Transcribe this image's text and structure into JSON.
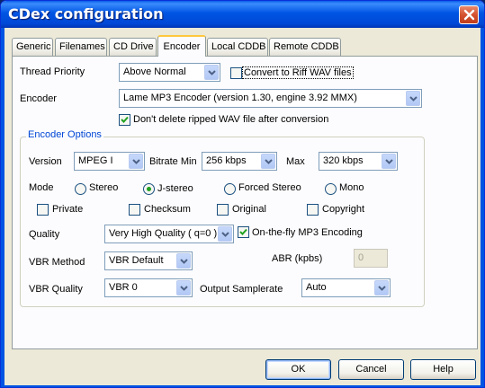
{
  "window": {
    "title": "CDex configuration"
  },
  "tabs": [
    {
      "label": "Generic"
    },
    {
      "label": "Filenames"
    },
    {
      "label": "CD Drive"
    },
    {
      "label": "Encoder",
      "active": true
    },
    {
      "label": "Local CDDB"
    },
    {
      "label": "Remote CDDB"
    }
  ],
  "form": {
    "thread_priority": {
      "label": "Thread Priority",
      "value": "Above Normal"
    },
    "convert_riff": {
      "label": "Convert to Riff WAV files",
      "checked": false
    },
    "encoder": {
      "label": "Encoder",
      "value": "Lame MP3 Encoder (version 1.30, engine 3.92 MMX)"
    },
    "dont_delete": {
      "label": "Don't delete ripped WAV file after conversion",
      "checked": true
    }
  },
  "encoder_options": {
    "title": "Encoder Options",
    "version": {
      "label": "Version",
      "value": "MPEG I"
    },
    "bitrate_min": {
      "label": "Bitrate Min",
      "value": "256 kbps"
    },
    "bitrate_max": {
      "label": "Max",
      "value": "320 kbps"
    },
    "mode": {
      "label": "Mode",
      "options": [
        "Stereo",
        "J-stereo",
        "Forced Stereo",
        "Mono"
      ],
      "selected": "J-stereo"
    },
    "flags": [
      {
        "label": "Private",
        "checked": false
      },
      {
        "label": "Checksum",
        "checked": false
      },
      {
        "label": "Original",
        "checked": false
      },
      {
        "label": "Copyright",
        "checked": false
      }
    ],
    "quality": {
      "label": "Quality",
      "value": "Very High Quality ( q=0 )"
    },
    "on_the_fly": {
      "label": "On-the-fly MP3 Encoding",
      "checked": true
    },
    "vbr_method": {
      "label": "VBR Method",
      "value": "VBR Default"
    },
    "abr": {
      "label": "ABR (kpbs)",
      "value": "0"
    },
    "vbr_quality": {
      "label": "VBR Quality",
      "value": "VBR 0"
    },
    "output_samplerate": {
      "label": "Output Samplerate",
      "value": "Auto"
    }
  },
  "buttons": {
    "ok": "OK",
    "cancel": "Cancel",
    "help": "Help"
  },
  "colors": {
    "titlebar": "#0054e3",
    "dialog_bg": "#ece9d8",
    "group_title": "#0046d5",
    "tab_highlight": "#ffc73c"
  }
}
